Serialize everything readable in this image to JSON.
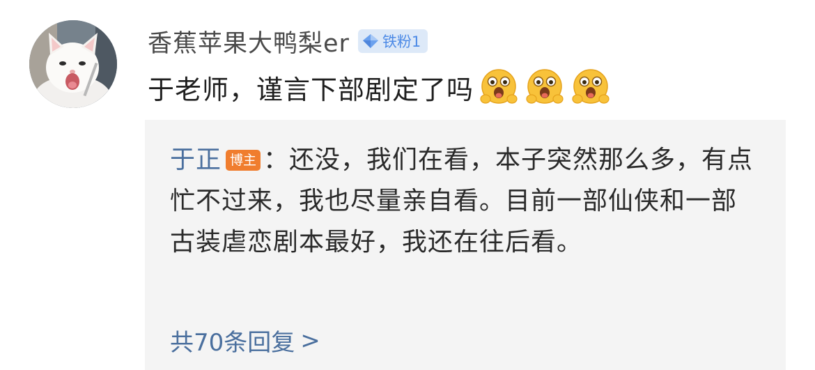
{
  "comment": {
    "avatar_icon": "white-kitten-avatar",
    "username": "香蕉苹果大鸭梨er",
    "fan_badge": {
      "icon": "diamond-icon",
      "label": "铁粉1",
      "bg_color": "#dde9f8",
      "text_color": "#4d8ae6"
    },
    "text": "于老师，谨言下部剧定了吗",
    "emojis": [
      "excited-face-icon",
      "excited-face-icon",
      "excited-face-icon"
    ]
  },
  "reply": {
    "author": "于正",
    "host_badge": "博主",
    "host_badge_color": "#f07d2e",
    "colon": "：",
    "text": "还没，我们在看，本子突然那么多，有点忙不过来，我也尽量亲自看。目前一部仙侠和一部古装虐恋剧本最好，我还在往后看。",
    "link_color": "#4a6f9e"
  },
  "more_replies": {
    "label": "共70条回复",
    "arrow": ">"
  }
}
